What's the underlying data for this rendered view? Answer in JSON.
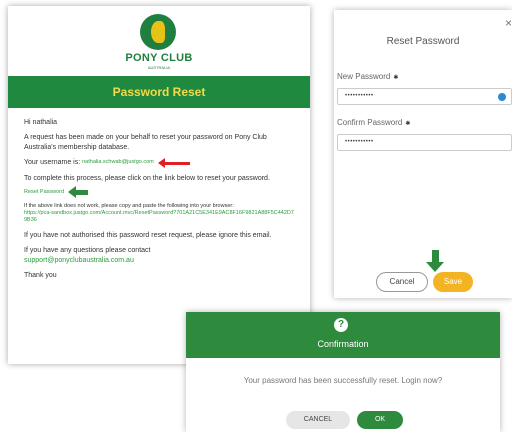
{
  "email": {
    "brand": "PONY CLUB",
    "brand_sub": "AUSTRALIA",
    "banner_title": "Password Reset",
    "greeting": "Hi nathalia",
    "intro": "A request has been made on your behalf to reset your password on Pony Club Australia's membership database.",
    "username_label": "Your username is:",
    "username_value": "nathalia.schwab@justgo.com",
    "complete_text": "To complete this process, please click on the link below to reset your password.",
    "reset_link": "Reset Password",
    "fallback_text": "If the above link does not work, please copy and paste the following into your browser:",
    "fallback_url": "https://pca-sandbox.justgo.com/Account.mvc/ResetPassword?701A21C5E341E9AC8F16F9821A88F5C442D79B36",
    "not_authorised": "If you have not authorised this password reset request, please ignore this email.",
    "questions": "If you have any questions please contact",
    "support_email": "support@ponyclubaustralia.com.au",
    "thanks": "Thank you"
  },
  "reset_dialog": {
    "close": "×",
    "title": "Reset Password",
    "new_label": "New Password",
    "new_value": "•••••••••••",
    "confirm_label": "Confirm Password",
    "confirm_value": "•••••••••••",
    "required_mark": "✱",
    "cancel": "Cancel",
    "save": "Save"
  },
  "confirm_dialog": {
    "icon": "?",
    "title": "Confirmation",
    "message": "Your password has been successfully reset. Login now?",
    "cancel": "CANCEL",
    "ok": "OK"
  },
  "colors": {
    "brand_green": "#1f8a3f",
    "banner_text": "#f5d94a",
    "save_orange": "#f2b423",
    "alert_red": "#e02020"
  }
}
